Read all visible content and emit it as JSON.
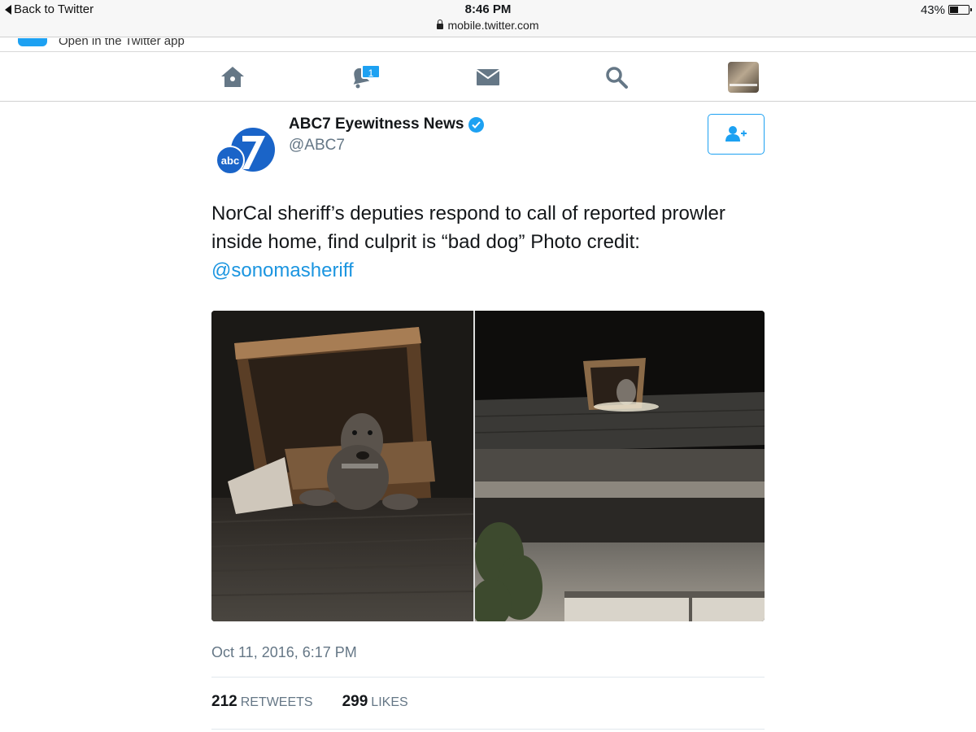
{
  "status_bar": {
    "back_label": "Back to Twitter",
    "time": "8:46 PM",
    "url": "mobile.twitter.com",
    "battery_pct_text": "43%",
    "battery_level": 0.43
  },
  "banner": {
    "text": "Open in the Twitter app"
  },
  "nav": {
    "notifications_badge": "1",
    "icons": [
      "home-icon",
      "notifications-icon",
      "messages-icon",
      "search-icon",
      "profile-avatar"
    ]
  },
  "tweet": {
    "author_name": "ABC7 Eyewitness News",
    "author_handle": "@ABC7",
    "verified": true,
    "text": "NorCal sheriff’s deputies respond to call of reported prowler inside home, find culprit is “bad dog” Photo credit:",
    "mention": "@sonomasheriff",
    "timestamp": "Oct 11, 2016, 6:17 PM",
    "retweets_count": "212",
    "retweets_label": "RETWEETS",
    "likes_count": "299",
    "likes_label": "LIKES"
  },
  "colors": {
    "twitter_blue": "#1da1f2",
    "link_blue": "#1b95e0",
    "muted_gray": "#657786",
    "abc_blue": "#1a64c8"
  }
}
